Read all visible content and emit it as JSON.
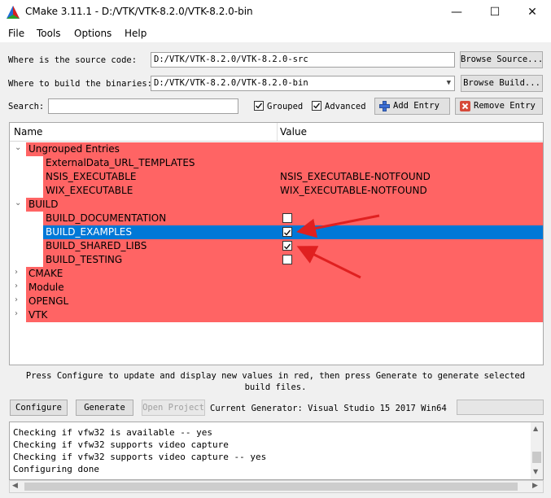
{
  "window": {
    "title": "CMake 3.11.1 - D:/VTK/VTK-8.2.0/VTK-8.2.0-bin",
    "minimize_glyph": "—",
    "maximize_glyph": "☐",
    "close_glyph": "✕"
  },
  "menu": [
    "File",
    "Tools",
    "Options",
    "Help"
  ],
  "source": {
    "label": "Where is the source code:",
    "value": "D:/VTK/VTK-8.2.0/VTK-8.2.0-src",
    "browse": "Browse Source..."
  },
  "build": {
    "label": "Where to build the binaries:",
    "value": "D:/VTK/VTK-8.2.0/VTK-8.2.0-bin",
    "browse": "Browse Build..."
  },
  "search": {
    "label": "Search:",
    "value": "",
    "grouped_label": "Grouped",
    "grouped_checked": true,
    "advanced_label": "Advanced",
    "advanced_checked": true,
    "add_entry": "Add Entry",
    "remove_entry": "Remove Entry"
  },
  "tree": {
    "col_name": "Name",
    "col_value": "Value",
    "rows": [
      {
        "level": 0,
        "expanded": true,
        "name": "Ungrouped Entries",
        "value": ""
      },
      {
        "level": 1,
        "name": "ExternalData_URL_TEMPLATES",
        "value": ""
      },
      {
        "level": 1,
        "name": "NSIS_EXECUTABLE",
        "value": "NSIS_EXECUTABLE-NOTFOUND"
      },
      {
        "level": 1,
        "name": "WIX_EXECUTABLE",
        "value": "WIX_EXECUTABLE-NOTFOUND"
      },
      {
        "level": 0,
        "expanded": true,
        "name": "BUILD",
        "value": ""
      },
      {
        "level": 1,
        "name": "BUILD_DOCUMENTATION",
        "checkbox": true,
        "checked": false
      },
      {
        "level": 1,
        "name": "BUILD_EXAMPLES",
        "checkbox": true,
        "checked": true,
        "selected": true
      },
      {
        "level": 1,
        "name": "BUILD_SHARED_LIBS",
        "checkbox": true,
        "checked": true
      },
      {
        "level": 1,
        "name": "BUILD_TESTING",
        "checkbox": true,
        "checked": false
      },
      {
        "level": 0,
        "expanded": false,
        "name": "CMAKE",
        "value": ""
      },
      {
        "level": 0,
        "expanded": false,
        "name": "Module",
        "value": ""
      },
      {
        "level": 0,
        "expanded": false,
        "name": "OPENGL",
        "value": ""
      },
      {
        "level": 0,
        "expanded": false,
        "name": "VTK",
        "value": ""
      }
    ]
  },
  "status_message": "Press Configure to update and display new values in red, then press Generate to generate selected build files.",
  "actions": {
    "configure": "Configure",
    "generate": "Generate",
    "open_project": "Open Project",
    "generator": "Current Generator: Visual Studio 15 2017 Win64"
  },
  "output": [
    "Checking if vfw32 is available -- yes",
    "Checking if vfw32 supports video capture",
    "Checking if vfw32 supports video capture -- yes",
    "Configuring done"
  ],
  "colors": {
    "changed_row": "#ff6464",
    "selection": "#0078d7",
    "annotation_arrow": "#e02020"
  }
}
